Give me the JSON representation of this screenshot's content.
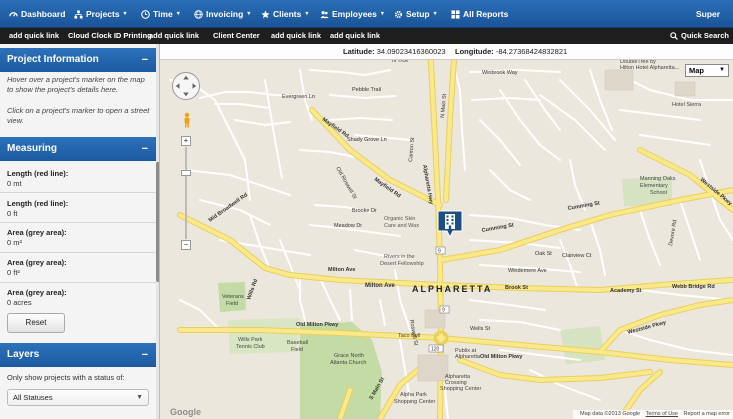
{
  "nav": {
    "items": [
      {
        "label": "Dashboard",
        "icon": "speedometer-icon",
        "has_caret": false
      },
      {
        "label": "Projects",
        "icon": "sitemap-icon",
        "has_caret": true
      },
      {
        "label": "Time",
        "icon": "clock-icon",
        "has_caret": true
      },
      {
        "label": "Invoicing",
        "icon": "globe-icon",
        "has_caret": true
      },
      {
        "label": "Clients",
        "icon": "star-icon",
        "has_caret": true
      },
      {
        "label": "Employees",
        "icon": "people-icon",
        "has_caret": true
      },
      {
        "label": "Setup",
        "icon": "gear-icon",
        "has_caret": true
      },
      {
        "label": "All Reports",
        "icon": "grid-icon",
        "has_caret": false
      }
    ],
    "user_label": "Super",
    "caret": "▾"
  },
  "quicklinks": {
    "items": [
      "add quick link",
      "Cloud Clock ID Printing",
      "add quick link",
      "Client Center",
      "add quick link",
      "add quick link"
    ],
    "search_label": "Quick Search"
  },
  "sidebar": {
    "project_info": {
      "title": "Project Information",
      "help1": "Hover over a project's marker on the map to show the project's details here.",
      "help2": "Click on a project's marker to open a street view."
    },
    "measuring": {
      "title": "Measuring",
      "fields": [
        {
          "label": "Length (red line):",
          "value": "0 mt"
        },
        {
          "label": "Length (red line):",
          "value": "0 ft"
        },
        {
          "label": "Area (grey area):",
          "value": "0 m²"
        },
        {
          "label": "Area (grey area):",
          "value": "0 ft²"
        },
        {
          "label": "Area (grey area):",
          "value": "0 acres"
        }
      ],
      "reset_label": "Reset"
    },
    "layers": {
      "title": "Layers",
      "filter_label": "Only show projects with a status of:",
      "status_value": "All Statuses"
    },
    "collapse_symbol": "−"
  },
  "map": {
    "latitude_label": "Latitude:",
    "latitude": "34.09023416360023",
    "longitude_label": "Longitude:",
    "longitude": "-84.27368424832821",
    "map_type": "Map",
    "attribution": "Map data ©2013 Google",
    "terms": "Terms of Use",
    "report": "Report a map error",
    "google_logo": "Google",
    "labels": {
      "n_trce": "N Trce",
      "winbrook": "Winbrook Way",
      "doubletree": "DoubleTree by",
      "hilton": "Hilton Hotel Alpharetta...",
      "hotel_sierra": "Hotel Sierra",
      "evergreen": "Evergreen Ln",
      "pebble": "Pebble Trail",
      "mayfield": "Mayfield Rd",
      "shady": "Shady Grove Ln",
      "canton": "Canton St",
      "alpharetta_hwy": "Alpharetta Hwy",
      "cumming": "Cumming St",
      "manning": "Manning Oaks",
      "elementary": "Elementary",
      "school": "School",
      "westside": "Westside Pkwy",
      "old_roswell": "Old Roswell St",
      "mid_broadwell": "Mid Broadwell Rd",
      "brooke": "Brooke Dr",
      "meadow": "Meadow Dr",
      "organic": "Organic Skin",
      "care_wax": "Care and Wax",
      "rivers": "Rivers in the",
      "desert": "Desert Fellowship",
      "milton": "Milton Ave",
      "alpharetta": "ALPHARETTA",
      "brook_st": "Brook St",
      "academy": "Academy St",
      "webb_bridge": "Webb Bridge Rd",
      "veterans": "Veterans",
      "field": "Field",
      "wills_rd": "Wills Rd",
      "old_milton": "Old Milton Pkwy",
      "publix": "Publix at",
      "publix2": "Alpharetta",
      "taco": "Taco Bell",
      "wills_park": "Wills Park",
      "tennis": "Tennis Club",
      "baseball": "Baseball",
      "field2": "Field",
      "grace": "Grace North",
      "atlanta_church": "Atlanta Church",
      "alpha_park": "Alpha Park",
      "shopping": "Shopping Center",
      "alpharetta_crossing": "Alpharetta",
      "crossing": "Crossing",
      "shopping2": "Shopping Center",
      "s_main": "S Main St",
      "westside2": "Westside Pkwy",
      "old_milton2": "Old Milton Pkwy",
      "oak_st": "Oak St",
      "clairview": "Clairview Ct",
      "windemere": "Windemere Ave",
      "wells": "Wells St",
      "roswell": "Roswell St",
      "devore": "Devore Rd",
      "milton2": "Milton Ave",
      "n_main": "N Main St"
    },
    "colors": {
      "major_road": "#f9e98a",
      "minor_road": "#ffffff",
      "park": "#c3dba5",
      "land": "#ece7dd",
      "marker": "#1c4f86"
    }
  }
}
